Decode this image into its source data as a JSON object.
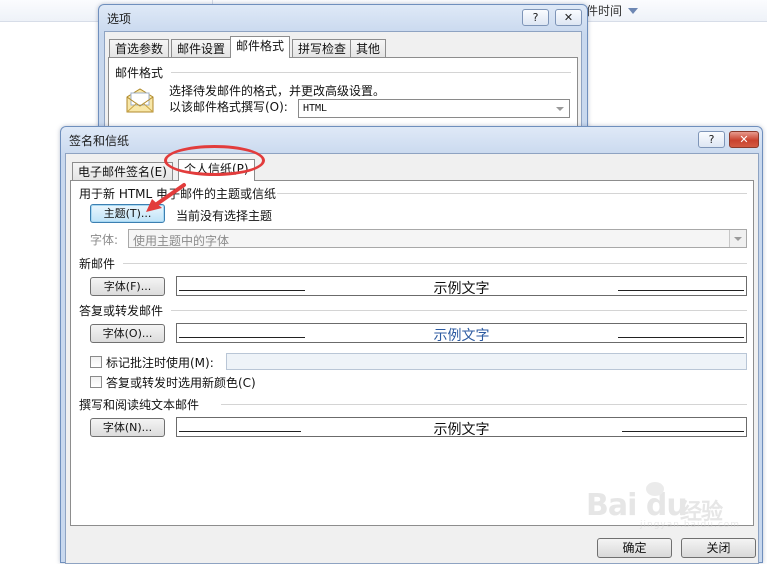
{
  "background": {
    "column_header": "件时间"
  },
  "options_dialog": {
    "title": "选项",
    "help_label": "?",
    "close_label": "✕",
    "tabs": [
      {
        "label": "首选参数"
      },
      {
        "label": "邮件设置"
      },
      {
        "label": "邮件格式"
      },
      {
        "label": "拼写检查"
      },
      {
        "label": "其他"
      }
    ],
    "active_tab": 2,
    "group_title": "邮件格式",
    "description": "选择待发邮件的格式，并更改高级设置。",
    "compose_label": "以该邮件格式撰写(O):",
    "compose_value": "HTML"
  },
  "signature_dialog": {
    "title": "签名和信纸",
    "help_label": "?",
    "close_label": "✕",
    "tabs": [
      {
        "label": "电子邮件签名(E)"
      },
      {
        "label": "个人信纸(P)"
      }
    ],
    "active_tab": 1,
    "theme_section": {
      "title": "用于新 HTML 电子邮件的主题或信纸",
      "theme_button": "主题(T)...",
      "status": "当前没有选择主题",
      "font_label": "字体:",
      "font_value": "使用主题中的字体"
    },
    "new_mail": {
      "title": "新邮件",
      "font_button": "字体(F)...",
      "sample": "示例文字"
    },
    "reply_forward": {
      "title": "答复或转发邮件",
      "font_button": "字体(O)...",
      "sample": "示例文字",
      "mark_comments_label": "标记批注时使用(M):",
      "mark_comments_value": "",
      "new_color_label": "答复或转发时选用新颜色(C)"
    },
    "plain_text": {
      "title": "撰写和阅读纯文本邮件",
      "font_button": "字体(N)...",
      "sample": "示例文字"
    },
    "ok_button": "确定",
    "close_button": "关闭"
  },
  "colors": {
    "annotation": "#e23c3c",
    "sample_blue": "#2c5aa0"
  },
  "watermark": {
    "brand": "Bai du",
    "suffix": "经验",
    "url": "jingyan.baidu.com"
  }
}
